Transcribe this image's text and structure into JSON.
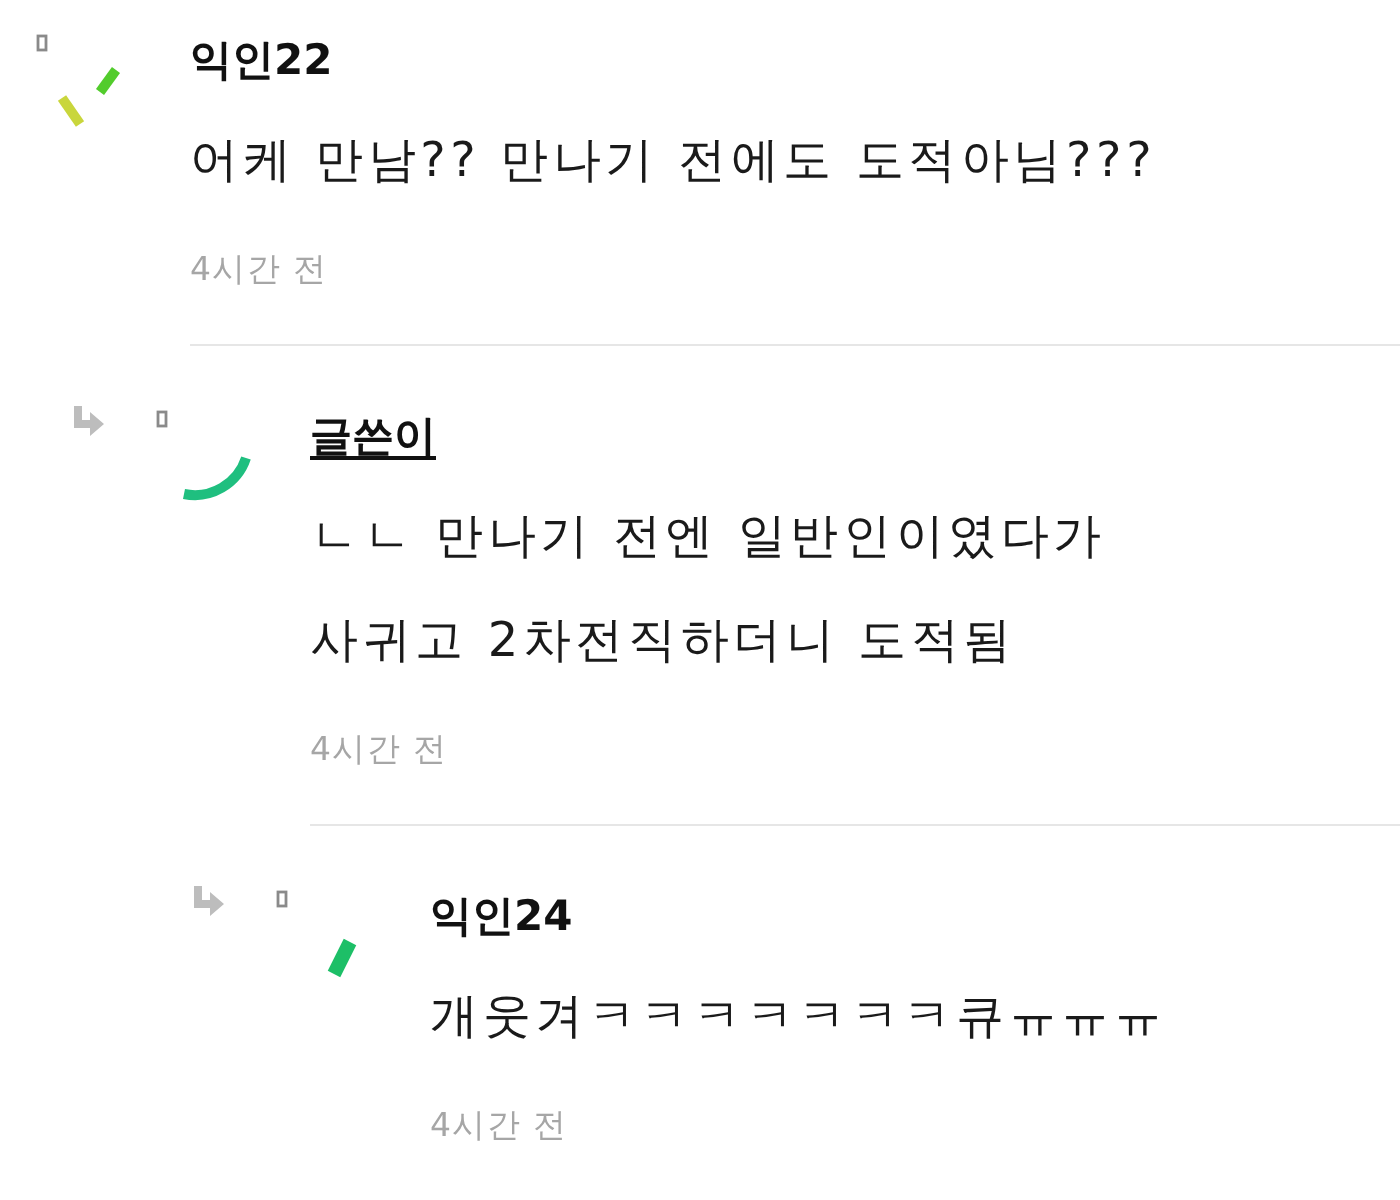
{
  "comments": [
    {
      "author": "익인22",
      "is_writer": false,
      "avatar": {
        "kind": "ticks"
      },
      "body": "어케 만남?? 만나기 전에도 도적아님???",
      "time": "4시간 전",
      "children": [
        {
          "author": "글쓴이",
          "is_writer": true,
          "avatar": {
            "kind": "arc"
          },
          "body": "ㄴㄴ 만나기 전엔 일반인이였다가\n사귀고 2차전직하더니 도적됨",
          "time": "4시간 전",
          "children": [
            {
              "author": "익인24",
              "is_writer": false,
              "avatar": {
                "kind": "bar"
              },
              "body": "개웃겨ㅋㅋㅋㅋㅋㅋㅋ큐ㅠㅠㅠ",
              "time": "4시간 전"
            }
          ]
        }
      ]
    }
  ]
}
